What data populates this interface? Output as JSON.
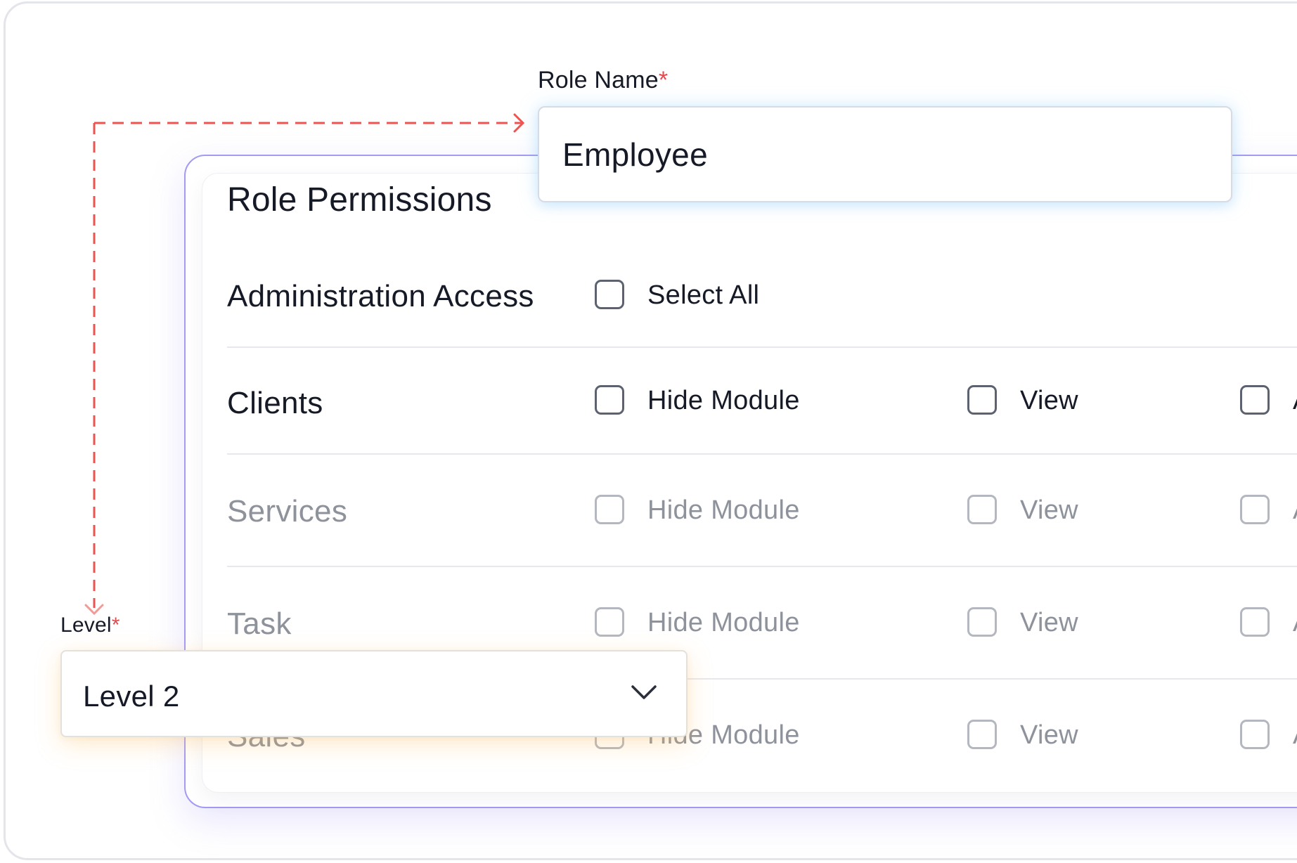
{
  "role_name": {
    "label": "Role Name",
    "required_mark": "*",
    "value": "Employee"
  },
  "level": {
    "label": "Level",
    "required_mark": "*",
    "selected": "Level 2"
  },
  "permissions": {
    "title": "Role Permissions",
    "admin": {
      "label": "Administration Access",
      "select_all_label": "Select All"
    },
    "rows": [
      {
        "label": "Clients",
        "option1": "Hide Module",
        "option2": "View",
        "option3": "A"
      },
      {
        "label": "Services",
        "option1": "Hide Module",
        "option2": "View",
        "option3": "A"
      },
      {
        "label": "Task",
        "option1": "Hide Module",
        "option2": "View",
        "option3": "A"
      },
      {
        "label": "Sales",
        "option1": "Hide Module",
        "option2": "View",
        "option3": "A"
      }
    ]
  },
  "icons": {
    "dropdown": "chevron-down-icon",
    "connector": "dashed-arrow-connector"
  },
  "colors": {
    "required": "#e5484d",
    "card_border": "#a29af3",
    "connector": "#ef5350"
  }
}
